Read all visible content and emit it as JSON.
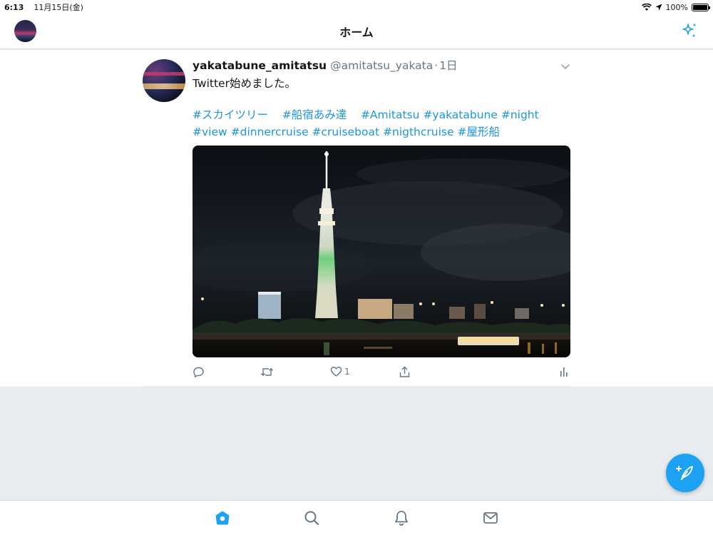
{
  "status_bar": {
    "time": "6:13",
    "date": "11月15日(金)",
    "battery": "100%",
    "battery_level": 1.0
  },
  "nav": {
    "title": "ホーム",
    "avatar_icon": "user-avatar",
    "sparkle_icon": "sparkle-icon"
  },
  "tweet": {
    "display_name": "yakatabune_amitatsu",
    "handle": "@amitatsu_yakata",
    "separator": "·",
    "time": "1日",
    "text": "Twitter始めました。",
    "hashtags_line1": [
      "#スカイツリー",
      "#船宿あみ達",
      "#Amitatsu",
      "#yakatabune",
      "#night"
    ],
    "hashtags_line2": [
      "#view",
      "#dinnercruise",
      "#cruiseboat",
      "#nigthcruise",
      "#屋形船"
    ],
    "image_description_icon": "tweet-photo",
    "actions": {
      "reply_icon": "reply-icon",
      "retweet_icon": "retweet-icon",
      "like_icon": "like-icon",
      "like_count": "1",
      "share_icon": "share-icon",
      "analytics_icon": "analytics-icon"
    }
  },
  "tabs": [
    "home-icon",
    "search-icon",
    "notifications-icon",
    "messages-icon"
  ],
  "colors": {
    "accent": "#1da1f2",
    "link": "#1b95e0",
    "muted": "#657786",
    "background": "#e6ecf0"
  }
}
